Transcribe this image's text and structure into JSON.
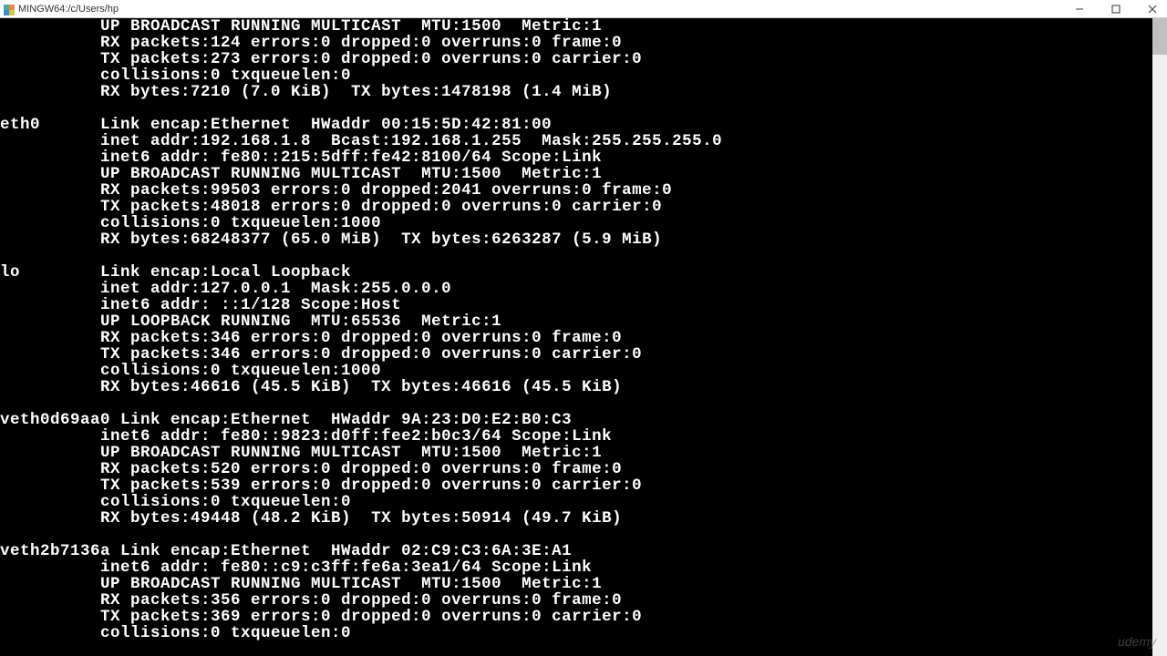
{
  "window": {
    "title": "MINGW64:/c/Users/hp"
  },
  "terminal": {
    "lines": [
      "          UP BROADCAST RUNNING MULTICAST  MTU:1500  Metric:1",
      "          RX packets:124 errors:0 dropped:0 overruns:0 frame:0",
      "          TX packets:273 errors:0 dropped:0 overruns:0 carrier:0",
      "          collisions:0 txqueuelen:0",
      "          RX bytes:7210 (7.0 KiB)  TX bytes:1478198 (1.4 MiB)",
      "",
      "eth0      Link encap:Ethernet  HWaddr 00:15:5D:42:81:00",
      "          inet addr:192.168.1.8  Bcast:192.168.1.255  Mask:255.255.255.0",
      "          inet6 addr: fe80::215:5dff:fe42:8100/64 Scope:Link",
      "          UP BROADCAST RUNNING MULTICAST  MTU:1500  Metric:1",
      "          RX packets:99503 errors:0 dropped:2041 overruns:0 frame:0",
      "          TX packets:48018 errors:0 dropped:0 overruns:0 carrier:0",
      "          collisions:0 txqueuelen:1000",
      "          RX bytes:68248377 (65.0 MiB)  TX bytes:6263287 (5.9 MiB)",
      "",
      "lo        Link encap:Local Loopback",
      "          inet addr:127.0.0.1  Mask:255.0.0.0",
      "          inet6 addr: ::1/128 Scope:Host",
      "          UP LOOPBACK RUNNING  MTU:65536  Metric:1",
      "          RX packets:346 errors:0 dropped:0 overruns:0 frame:0",
      "          TX packets:346 errors:0 dropped:0 overruns:0 carrier:0",
      "          collisions:0 txqueuelen:1000",
      "          RX bytes:46616 (45.5 KiB)  TX bytes:46616 (45.5 KiB)",
      "",
      "veth0d69aa0 Link encap:Ethernet  HWaddr 9A:23:D0:E2:B0:C3",
      "          inet6 addr: fe80::9823:d0ff:fee2:b0c3/64 Scope:Link",
      "          UP BROADCAST RUNNING MULTICAST  MTU:1500  Metric:1",
      "          RX packets:520 errors:0 dropped:0 overruns:0 frame:0",
      "          TX packets:539 errors:0 dropped:0 overruns:0 carrier:0",
      "          collisions:0 txqueuelen:0",
      "          RX bytes:49448 (48.2 KiB)  TX bytes:50914 (49.7 KiB)",
      "",
      "veth2b7136a Link encap:Ethernet  HWaddr 02:C9:C3:6A:3E:A1",
      "          inet6 addr: fe80::c9:c3ff:fe6a:3ea1/64 Scope:Link",
      "          UP BROADCAST RUNNING MULTICAST  MTU:1500  Metric:1",
      "          RX packets:356 errors:0 dropped:0 overruns:0 frame:0",
      "          TX packets:369 errors:0 dropped:0 overruns:0 carrier:0",
      "          collisions:0 txqueuelen:0"
    ]
  },
  "watermark": "udemy"
}
